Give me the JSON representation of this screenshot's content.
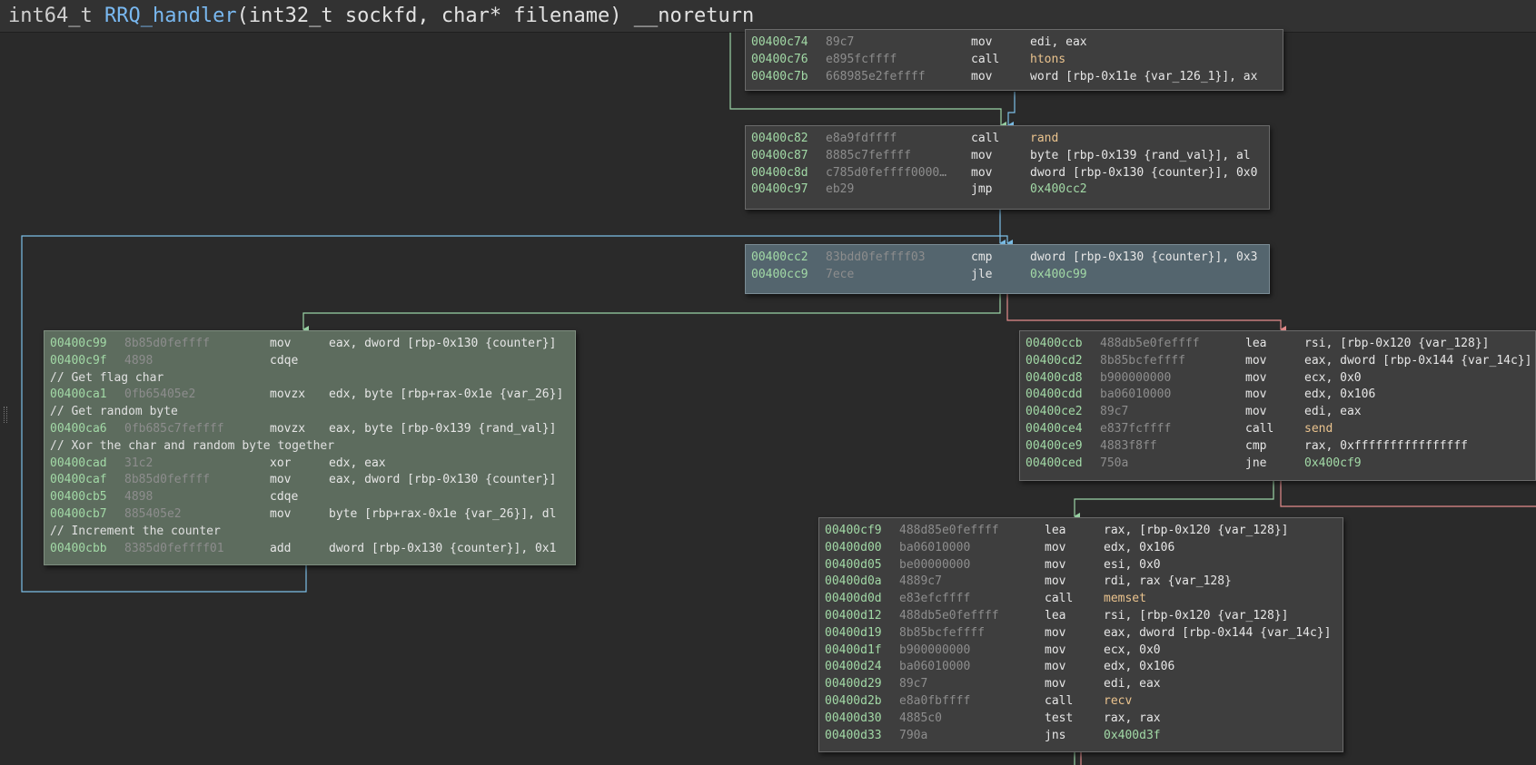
{
  "title": {
    "return_type": "int64_t",
    "function_name": "RRQ_handler",
    "params": "(int32_t sockfd, char* filename)",
    "attribute": "__noreturn"
  },
  "colors": {
    "background": "#2a2a2a",
    "block": "#3e3e3e",
    "highlight_block": "#54656e",
    "green_block": "#5d6c5e",
    "address": "#a2d9a6",
    "symbol": "#eac38e",
    "edge_true": "#9bd4a6",
    "edge_false": "#e38c8c",
    "edge_unconditional": "#7cbfe8"
  },
  "blocks": {
    "b0": {
      "lines": [
        {
          "addr": "00400c74",
          "bytes": "89c7",
          "mnem": "mov",
          "ops": "edi, eax"
        },
        {
          "addr": "00400c76",
          "bytes": "e895fcffff",
          "mnem": "call",
          "ops": "htons"
        },
        {
          "addr": "00400c7b",
          "bytes": "668985e2feffff",
          "mnem": "mov",
          "ops": "word [rbp-0x11e {var_126_1}], ax"
        }
      ]
    },
    "b1": {
      "lines": [
        {
          "addr": "00400c82",
          "bytes": "e8a9fdffff",
          "mnem": "call",
          "ops": "rand"
        },
        {
          "addr": "00400c87",
          "bytes": "8885c7feffff",
          "mnem": "mov",
          "ops": "byte [rbp-0x139 {rand_val}], al"
        },
        {
          "addr": "00400c8d",
          "bytes": "c785d0feffff0000…",
          "mnem": "mov",
          "ops": "dword [rbp-0x130 {counter}], 0x0"
        },
        {
          "addr": "00400c97",
          "bytes": "eb29",
          "mnem": "jmp",
          "ops": "0x400cc2"
        }
      ]
    },
    "b2": {
      "lines": [
        {
          "addr": "00400cc2",
          "bytes": "83bdd0feffff03",
          "mnem": "cmp",
          "ops": "dword [rbp-0x130 {counter}], 0x3"
        },
        {
          "addr": "00400cc9",
          "bytes": "7ece",
          "mnem": "jle",
          "ops": "0x400c99"
        }
      ]
    },
    "b3": {
      "lines": [
        {
          "addr": "00400c99",
          "bytes": "8b85d0feffff",
          "mnem": "mov",
          "ops": "eax, dword [rbp-0x130 {counter}]"
        },
        {
          "addr": "00400c9f",
          "bytes": "4898",
          "mnem": "cdqe",
          "ops": ""
        },
        {
          "comment": "// Get flag char"
        },
        {
          "addr": "00400ca1",
          "bytes": "0fb65405e2",
          "mnem": "movzx",
          "ops": "edx, byte [rbp+rax-0x1e {var_26}]"
        },
        {
          "comment": "// Get random byte"
        },
        {
          "addr": "00400ca6",
          "bytes": "0fb685c7feffff",
          "mnem": "movzx",
          "ops": "eax, byte [rbp-0x139 {rand_val}]"
        },
        {
          "comment": "// Xor the char and random byte together"
        },
        {
          "addr": "00400cad",
          "bytes": "31c2",
          "mnem": "xor",
          "ops": "edx, eax"
        },
        {
          "addr": "00400caf",
          "bytes": "8b85d0feffff",
          "mnem": "mov",
          "ops": "eax, dword [rbp-0x130 {counter}]"
        },
        {
          "addr": "00400cb5",
          "bytes": "4898",
          "mnem": "cdqe",
          "ops": ""
        },
        {
          "addr": "00400cb7",
          "bytes": "885405e2",
          "mnem": "mov",
          "ops": "byte [rbp+rax-0x1e {var_26}], dl"
        },
        {
          "comment": "// Increment the counter"
        },
        {
          "addr": "00400cbb",
          "bytes": "8385d0feffff01",
          "mnem": "add",
          "ops": "dword [rbp-0x130 {counter}], 0x1"
        }
      ]
    },
    "b4": {
      "lines": [
        {
          "addr": "00400ccb",
          "bytes": "488db5e0feffff",
          "mnem": "lea",
          "ops": "rsi, [rbp-0x120 {var_128}]"
        },
        {
          "addr": "00400cd2",
          "bytes": "8b85bcfeffff",
          "mnem": "mov",
          "ops": "eax, dword [rbp-0x144 {var_14c}]"
        },
        {
          "addr": "00400cd8",
          "bytes": "b900000000",
          "mnem": "mov",
          "ops": "ecx, 0x0"
        },
        {
          "addr": "00400cdd",
          "bytes": "ba06010000",
          "mnem": "mov",
          "ops": "edx, 0x106"
        },
        {
          "addr": "00400ce2",
          "bytes": "89c7",
          "mnem": "mov",
          "ops": "edi, eax"
        },
        {
          "addr": "00400ce4",
          "bytes": "e837fcffff",
          "mnem": "call",
          "ops": "send"
        },
        {
          "addr": "00400ce9",
          "bytes": "4883f8ff",
          "mnem": "cmp",
          "ops": "rax, 0xffffffffffffffff"
        },
        {
          "addr": "00400ced",
          "bytes": "750a",
          "mnem": "jne",
          "ops": "0x400cf9"
        }
      ]
    },
    "b5": {
      "lines": [
        {
          "addr": "00400cf9",
          "bytes": "488d85e0feffff",
          "mnem": "lea",
          "ops": "rax, [rbp-0x120 {var_128}]"
        },
        {
          "addr": "00400d00",
          "bytes": "ba06010000",
          "mnem": "mov",
          "ops": "edx, 0x106"
        },
        {
          "addr": "00400d05",
          "bytes": "be00000000",
          "mnem": "mov",
          "ops": "esi, 0x0"
        },
        {
          "addr": "00400d0a",
          "bytes": "4889c7",
          "mnem": "mov",
          "ops": "rdi, rax {var_128}"
        },
        {
          "addr": "00400d0d",
          "bytes": "e83efcffff",
          "mnem": "call",
          "ops": "memset"
        },
        {
          "addr": "00400d12",
          "bytes": "488db5e0feffff",
          "mnem": "lea",
          "ops": "rsi, [rbp-0x120 {var_128}]"
        },
        {
          "addr": "00400d19",
          "bytes": "8b85bcfeffff",
          "mnem": "mov",
          "ops": "eax, dword [rbp-0x144 {var_14c}]"
        },
        {
          "addr": "00400d1f",
          "bytes": "b900000000",
          "mnem": "mov",
          "ops": "ecx, 0x0"
        },
        {
          "addr": "00400d24",
          "bytes": "ba06010000",
          "mnem": "mov",
          "ops": "edx, 0x106"
        },
        {
          "addr": "00400d29",
          "bytes": "89c7",
          "mnem": "mov",
          "ops": "edi, eax"
        },
        {
          "addr": "00400d2b",
          "bytes": "e8a0fbffff",
          "mnem": "call",
          "ops": "recv"
        },
        {
          "addr": "00400d30",
          "bytes": "4885c0",
          "mnem": "test",
          "ops": "rax, rax"
        },
        {
          "addr": "00400d33",
          "bytes": "790a",
          "mnem": "jns",
          "ops": "0x400d3f"
        }
      ]
    }
  }
}
